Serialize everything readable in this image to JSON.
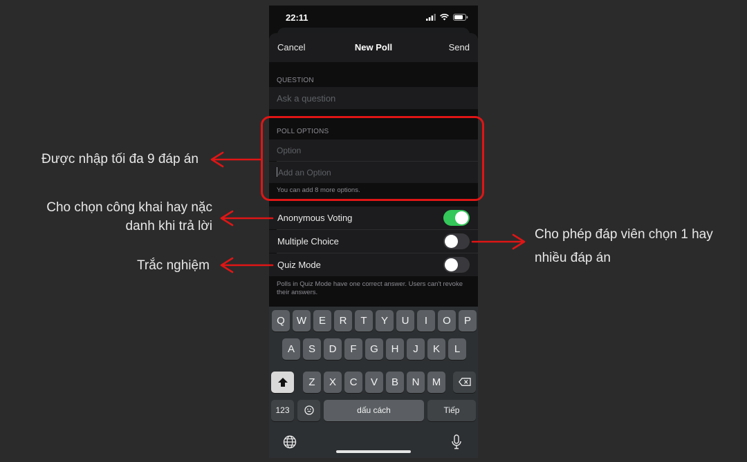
{
  "status_bar": {
    "time": "22:11"
  },
  "nav": {
    "cancel": "Cancel",
    "title": "New Poll",
    "send": "Send"
  },
  "question": {
    "section_label": "QUESTION",
    "placeholder": "Ask a question"
  },
  "poll_options": {
    "section_label": "POLL OPTIONS",
    "option_placeholder": "Option",
    "add_option_placeholder": "Add an Option",
    "hint": "You can add 8 more options."
  },
  "settings": {
    "anonymous_voting": {
      "label": "Anonymous Voting",
      "on": true
    },
    "multiple_choice": {
      "label": "Multiple Choice",
      "on": false
    },
    "quiz_mode": {
      "label": "Quiz Mode",
      "on": false
    },
    "quiz_hint": "Polls in Quiz Mode have one correct answer. Users can't revoke their answers."
  },
  "keyboard": {
    "row1": [
      "Q",
      "W",
      "E",
      "R",
      "T",
      "Y",
      "U",
      "I",
      "O",
      "P"
    ],
    "row2": [
      "A",
      "S",
      "D",
      "F",
      "G",
      "H",
      "J",
      "K",
      "L"
    ],
    "row3": [
      "Z",
      "X",
      "C",
      "V",
      "B",
      "N",
      "M"
    ],
    "numbers_key": "123",
    "space_key": "dấu cách",
    "return_key": "Tiếp"
  },
  "annotations": {
    "options_note": "Được nhập tối đa 9 đáp án",
    "anonymous_note_line1": "Cho chọn công khai hay nặc",
    "anonymous_note_line2": "danh khi trả lời",
    "quiz_note": "Trắc nghiệm",
    "multiple_note_line1": "Cho phép đáp viên chọn 1 hay",
    "multiple_note_line2": "nhiều đáp án",
    "arrow_color": "#e01515"
  }
}
